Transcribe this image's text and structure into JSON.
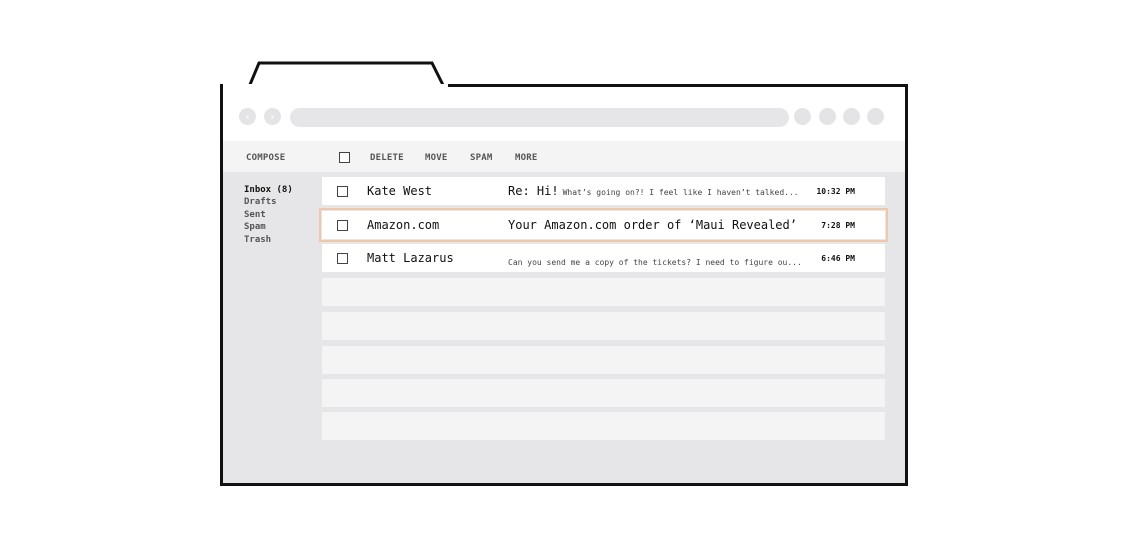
{
  "toolbar": {
    "compose": "COMPOSE",
    "delete": "DELETE",
    "move": "MOVE",
    "spam": "SPAM",
    "more": "MORE"
  },
  "nav": {
    "back_icon": "back-arrow-icon",
    "forward_icon": "forward-arrow-icon"
  },
  "folders": [
    {
      "label": "Inbox (8)",
      "active": true
    },
    {
      "label": "Drafts"
    },
    {
      "label": "Sent"
    },
    {
      "label": "Spam"
    },
    {
      "label": "Trash"
    }
  ],
  "emails": [
    {
      "sender": "Kate West",
      "subject": "Re: Hi!",
      "preview": "What’s going on?! I feel like I haven’t talked...",
      "time": "10:32 PM"
    },
    {
      "sender": "Amazon.com",
      "subject": "Your Amazon.com order of ‘Maui Revealed’",
      "preview": "",
      "time": "7:28 PM",
      "selected": true
    },
    {
      "sender": "Matt Lazarus",
      "subject": "",
      "preview": "Can you send me a copy of the tickets? I need to figure ou...",
      "time": "6:46 PM"
    }
  ],
  "colors": {
    "selected_outline": "#f0c7a8",
    "frame": "#111111",
    "background": "#e6e6e8"
  }
}
